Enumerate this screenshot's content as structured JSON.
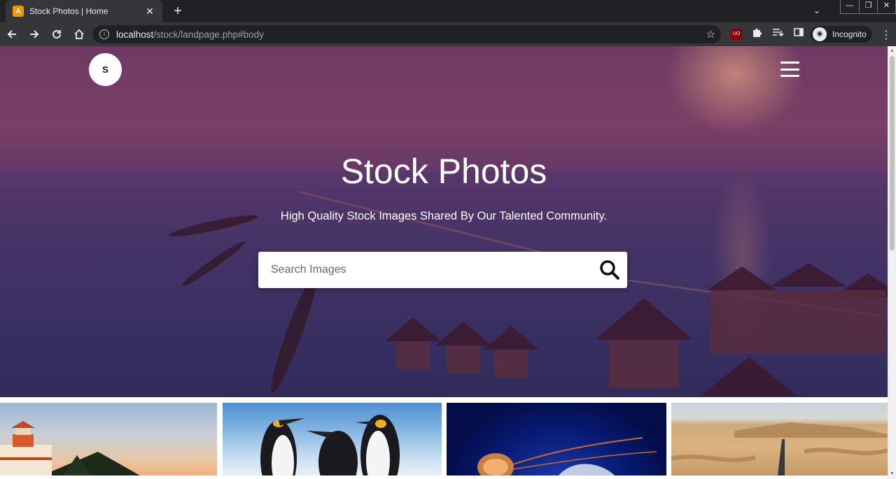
{
  "browser": {
    "tab_title": "Stock Photos | Home",
    "tab_favicon_text": "A",
    "url_host": "localhost",
    "url_path": "/stock/landpage.php#body",
    "profile_label": "Incognito",
    "ublock_text": "UO"
  },
  "site": {
    "logo_letter": "S",
    "hero_title": "Stock Photos",
    "hero_subtitle": "High Quality Stock Images Shared By Our Talented Community.",
    "search_placeholder": "Search Images"
  },
  "gallery": {
    "photos": [
      "lighthouse",
      "penguins",
      "jellyfish",
      "desert-road"
    ]
  },
  "colors": {
    "hero_overlay": "#6d3a63",
    "browser_frame": "#202124",
    "toolbar": "#35363a"
  }
}
